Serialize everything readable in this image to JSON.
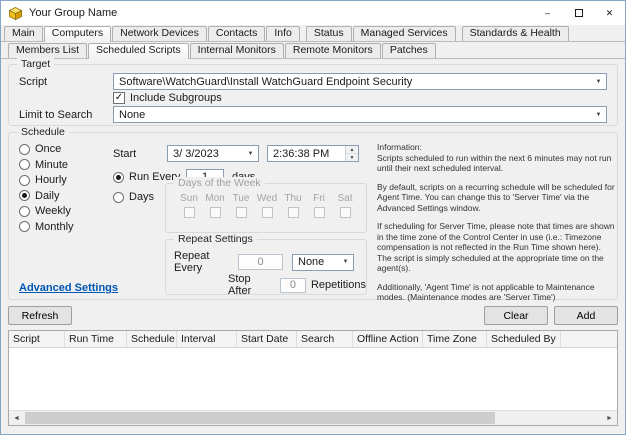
{
  "window": {
    "title": "Your Group Name"
  },
  "colors": {
    "link_blue": "#0056b3",
    "app_icon_yellow": "#f2c01d"
  },
  "main_tabs": [
    {
      "label": "Main",
      "active": false
    },
    {
      "label": "Computers",
      "active": true
    },
    {
      "label": "Network Devices",
      "active": false
    },
    {
      "label": "Contacts",
      "active": false
    },
    {
      "label": "Info",
      "active": false
    },
    {
      "label": "Status",
      "active": false
    },
    {
      "label": "Managed Services",
      "active": false
    },
    {
      "label": "Standards & Health",
      "active": false
    }
  ],
  "sub_tabs": [
    {
      "label": "Members List",
      "active": false
    },
    {
      "label": "Scheduled Scripts",
      "active": true
    },
    {
      "label": "Internal Monitors",
      "active": false
    },
    {
      "label": "Remote Monitors",
      "active": false
    },
    {
      "label": "Patches",
      "active": false
    }
  ],
  "target": {
    "legend": "Target",
    "script_label": "Script",
    "script_value": "Software\\WatchGuard\\Install WatchGuard Endpoint Security",
    "include_subgroups_label": "Include Subgroups",
    "include_subgroups_checked": true,
    "limit_label": "Limit to Search",
    "limit_value": "None"
  },
  "schedule": {
    "legend": "Schedule",
    "frequency_options": [
      {
        "label": "Once",
        "selected": false
      },
      {
        "label": "Minute",
        "selected": false
      },
      {
        "label": "Hourly",
        "selected": false
      },
      {
        "label": "Daily",
        "selected": true
      },
      {
        "label": "Weekly",
        "selected": false
      },
      {
        "label": "Monthly",
        "selected": false
      }
    ],
    "start": {
      "label": "Start",
      "date": "3/ 3/2023",
      "time": "2:36:38 PM"
    },
    "run_every": {
      "label": "Run Every",
      "selected": true,
      "value": "1",
      "unit": "days"
    },
    "days_mode": {
      "label": "Days",
      "selected": false
    },
    "days_of_week": {
      "legend": "Days of the Week",
      "days": [
        "Sun",
        "Mon",
        "Tue",
        "Wed",
        "Thu",
        "Fri",
        "Sat"
      ],
      "checked": [
        false,
        false,
        false,
        false,
        false,
        false,
        false
      ]
    },
    "repeat_settings": {
      "legend": "Repeat Settings",
      "repeat_every_label": "Repeat Every",
      "repeat_every_value": "0",
      "unit": "None",
      "stop_after_label": "Stop After",
      "stop_after_value": "0",
      "repetitions_label": "Repetitions"
    },
    "advanced_settings_link": "Advanced Settings",
    "information": {
      "heading": "Information:",
      "paragraphs": [
        "Scripts scheduled to run within the next 6 minutes may not run until their next scheduled interval.",
        "By default, scripts on a recurring schedule will be scheduled for Agent Time. You can change this to 'Server Time' via the Advanced Settings window.",
        "If scheduling for Server Time, please note that times are shown in the time zone of the Control Center in use (i.e.: Timezone compensation is not reflected in the Run Time shown here). The script is simply scheduled at the appropriate time on the agent(s).",
        "Additionally, 'Agent Time' is not applicable to Maintenance modes. (Maintenance modes are 'Server Time')"
      ]
    }
  },
  "actions": {
    "refresh": "Refresh",
    "clear": "Clear",
    "add": "Add"
  },
  "table": {
    "columns": [
      "Script",
      "Run Time",
      "Schedule",
      "Interval",
      "Start Date",
      "Search",
      "Offline Action",
      "Time Zone",
      "Scheduled By"
    ],
    "rows": []
  }
}
